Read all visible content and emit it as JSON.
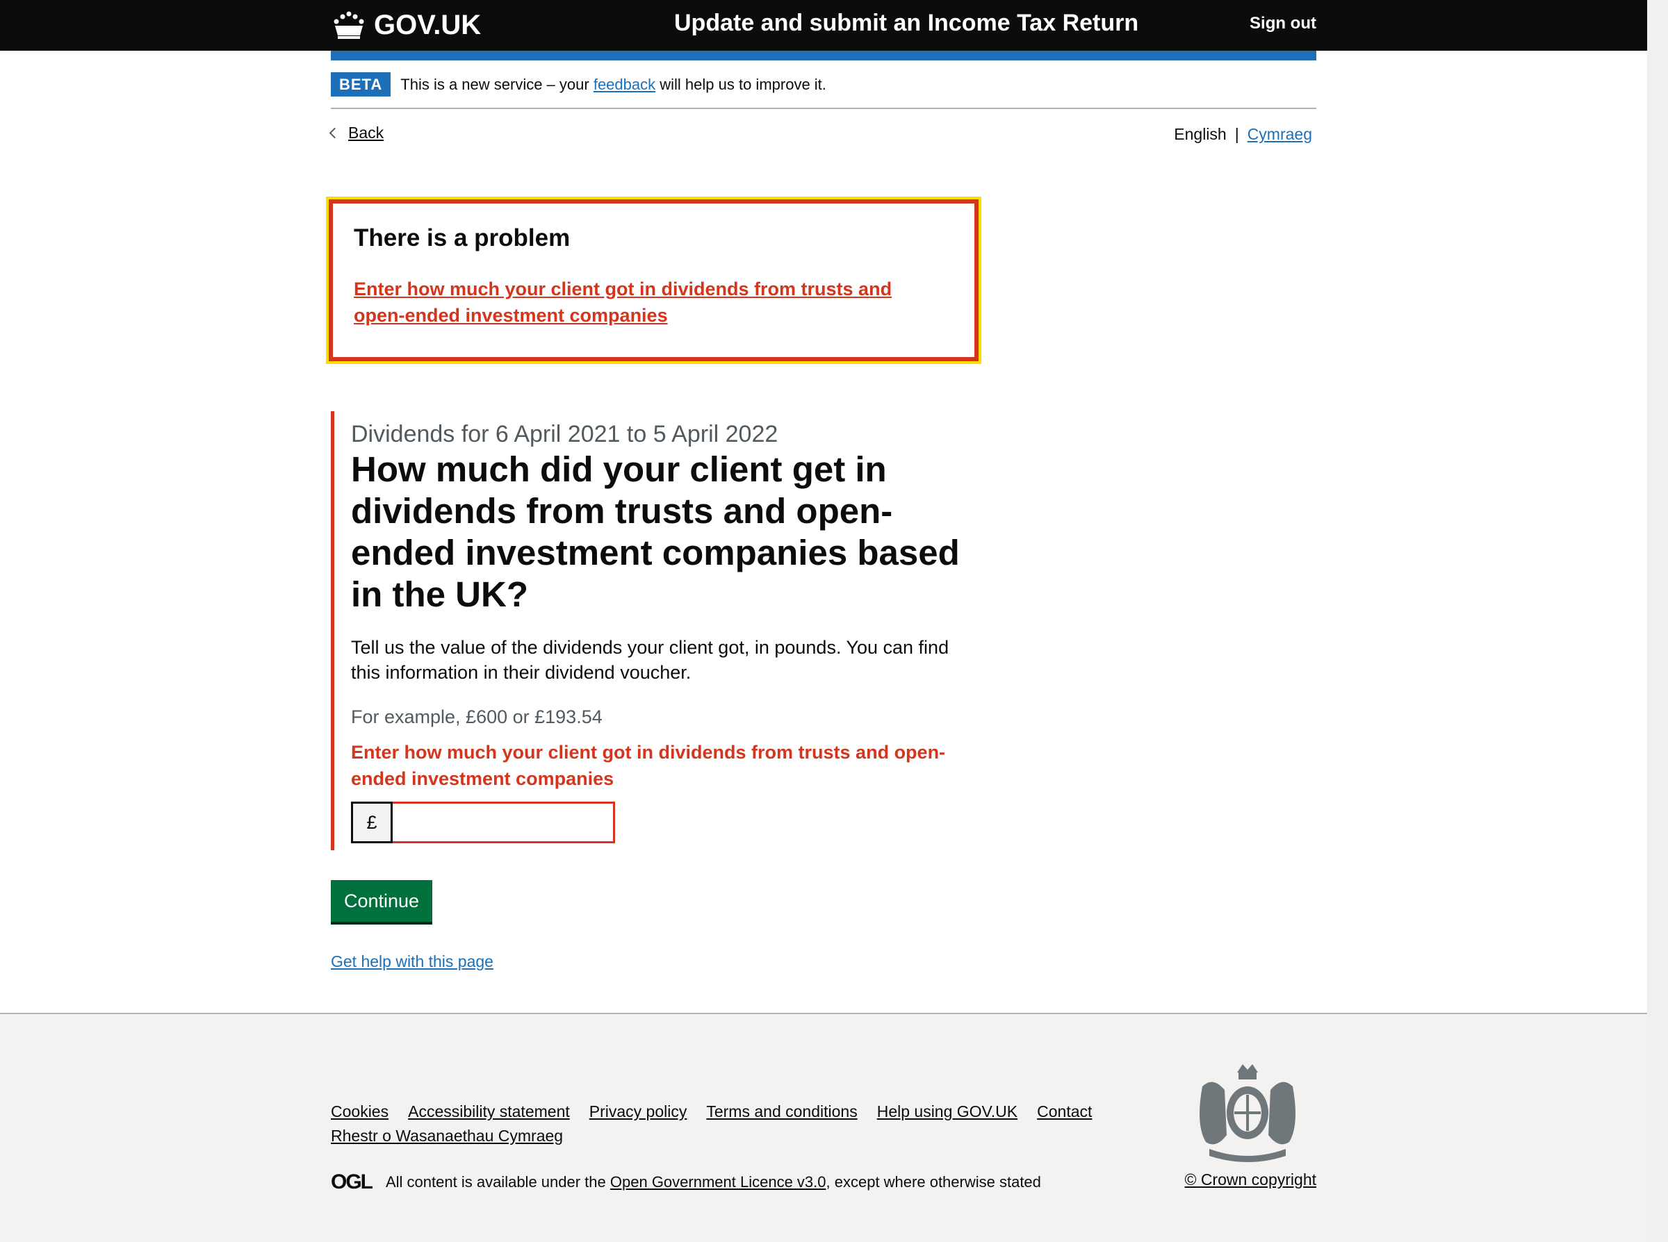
{
  "header": {
    "logo_text": "GOV.UK",
    "service_name": "Update and submit an Income Tax Return",
    "sign_out_label": "Sign out"
  },
  "phase_banner": {
    "tag": "BETA",
    "text_before": "This is a new service – your",
    "link_text": "feedback",
    "text_after": "will help us to improve it."
  },
  "nav": {
    "back_label": "Back",
    "language_current": "English",
    "language_separator": "|",
    "language_alternate": "Cymraeg"
  },
  "error_summary": {
    "title": "There is a problem",
    "error_link": "Enter how much your client got in dividends from trusts and open-ended investment companies"
  },
  "form": {
    "caption": "Dividends for 6 April 2021 to 5 April 2022",
    "heading": "How much did your client get in dividends from trusts and open-ended investment companies based in the UK?",
    "body_text": "Tell us the value of the dividends your client got, in pounds. You can find this information in their dividend voucher.",
    "hint": "For example, £600 or £193.54",
    "error_message": "Enter how much your client got in dividends from trusts and open-ended investment companies",
    "input_prefix": "£",
    "input_value": "",
    "continue_label": "Continue",
    "help_link": "Get help with this page"
  },
  "footer": {
    "links": [
      "Cookies",
      "Accessibility statement",
      "Privacy policy",
      "Terms and conditions",
      "Help using GOV.UK",
      "Contact",
      "Rhestr o Wasanaethau Cymraeg"
    ],
    "ogl_icon": "OGL",
    "licence_before": "All content is available under the",
    "licence_link": "Open Government Licence v3.0",
    "licence_after": ", except where otherwise stated",
    "copyright": "© Crown copyright"
  },
  "colors": {
    "header_bg": "#0b0c0c",
    "brand_blue": "#1d70b8",
    "error_red": "#d4351c",
    "button_green": "#00703c",
    "focus_yellow": "#ffdd00",
    "footer_bg": "#f3f2f1"
  },
  "icons": {
    "crown": "crown-icon",
    "back": "chevron-left-icon",
    "crest": "royal-coat-of-arms-icon"
  }
}
